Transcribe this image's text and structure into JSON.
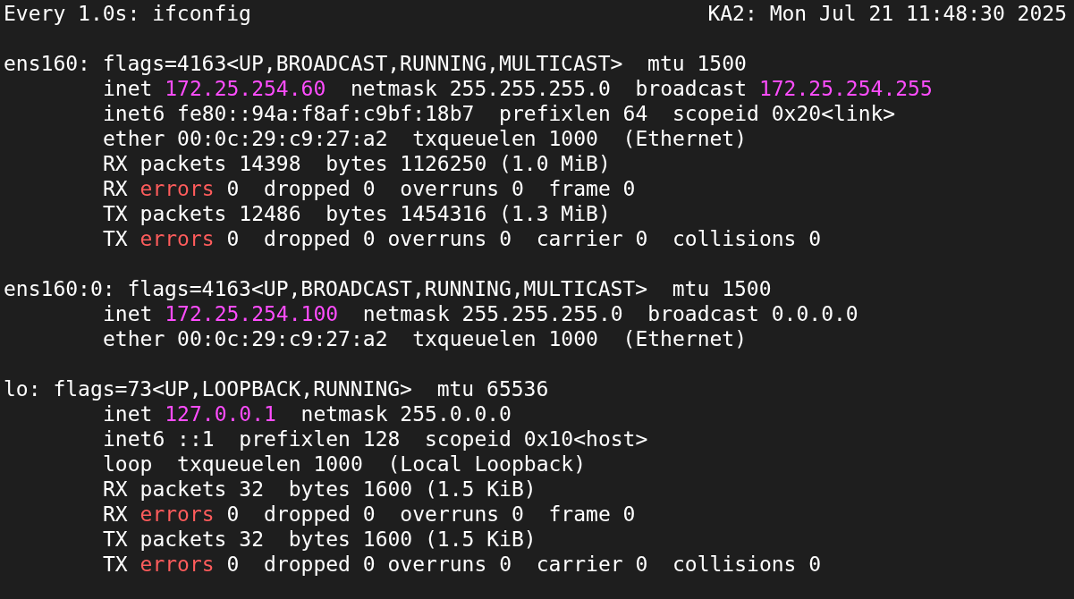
{
  "header": {
    "command": "Every 1.0s: ifconfig",
    "host_time": "KA2: Mon Jul 21 11:48:30 2025"
  },
  "interfaces": [
    {
      "segments": [
        {
          "text": "ens160: flags=4163<UP,BROADCAST,RUNNING,MULTICAST>  mtu 1500",
          "kind": "plain"
        }
      ],
      "children": [
        {
          "segments": [
            {
              "text": "inet ",
              "kind": "plain"
            },
            {
              "text": "172.25.254.60",
              "kind": "address"
            },
            {
              "text": "  netmask 255.255.255.0  broadcast ",
              "kind": "plain"
            },
            {
              "text": "172.25.254.255",
              "kind": "address"
            }
          ]
        },
        {
          "segments": [
            {
              "text": "inet6 fe80::94a:f8af:c9bf:18b7  prefixlen 64  scopeid 0x20<link>",
              "kind": "plain"
            }
          ]
        },
        {
          "segments": [
            {
              "text": "ether 00:0c:29:c9:27:a2  txqueuelen 1000  (Ethernet)",
              "kind": "plain"
            }
          ]
        },
        {
          "segments": [
            {
              "text": "RX packets 14398  bytes 1126250 (1.0 MiB)",
              "kind": "plain"
            }
          ]
        },
        {
          "segments": [
            {
              "text": "RX ",
              "kind": "plain"
            },
            {
              "text": "errors",
              "kind": "error"
            },
            {
              "text": " 0  dropped 0  overruns 0  frame 0",
              "kind": "plain"
            }
          ]
        },
        {
          "segments": [
            {
              "text": "TX packets 12486  bytes 1454316 (1.3 MiB)",
              "kind": "plain"
            }
          ]
        },
        {
          "segments": [
            {
              "text": "TX ",
              "kind": "plain"
            },
            {
              "text": "errors",
              "kind": "error"
            },
            {
              "text": " 0  dropped 0 overruns 0  carrier 0  collisions 0",
              "kind": "plain"
            }
          ]
        }
      ]
    },
    {
      "segments": [
        {
          "text": "ens160:0: flags=4163<UP,BROADCAST,RUNNING,MULTICAST>  mtu 1500",
          "kind": "plain"
        }
      ],
      "children": [
        {
          "segments": [
            {
              "text": "inet ",
              "kind": "plain"
            },
            {
              "text": "172.25.254.100",
              "kind": "address"
            },
            {
              "text": "  netmask 255.255.255.0  broadcast 0.0.0.0",
              "kind": "plain"
            }
          ]
        },
        {
          "segments": [
            {
              "text": "ether 00:0c:29:c9:27:a2  txqueuelen 1000  (Ethernet)",
              "kind": "plain"
            }
          ]
        }
      ]
    },
    {
      "segments": [
        {
          "text": "lo: flags=73<UP,LOOPBACK,RUNNING>  mtu 65536",
          "kind": "plain"
        }
      ],
      "children": [
        {
          "segments": [
            {
              "text": "inet ",
              "kind": "plain"
            },
            {
              "text": "127.0.0.1",
              "kind": "address"
            },
            {
              "text": "  netmask 255.0.0.0",
              "kind": "plain"
            }
          ]
        },
        {
          "segments": [
            {
              "text": "inet6 ::1  prefixlen 128  scopeid 0x10<host>",
              "kind": "plain"
            }
          ]
        },
        {
          "segments": [
            {
              "text": "loop  txqueuelen 1000  (Local Loopback)",
              "kind": "plain"
            }
          ]
        },
        {
          "segments": [
            {
              "text": "RX packets 32  bytes 1600 (1.5 KiB)",
              "kind": "plain"
            }
          ]
        },
        {
          "segments": [
            {
              "text": "RX ",
              "kind": "plain"
            },
            {
              "text": "errors",
              "kind": "error"
            },
            {
              "text": " 0  dropped 0  overruns 0  frame 0",
              "kind": "plain"
            }
          ]
        },
        {
          "segments": [
            {
              "text": "TX packets 32  bytes 1600 (1.5 KiB)",
              "kind": "plain"
            }
          ]
        },
        {
          "segments": [
            {
              "text": "TX ",
              "kind": "plain"
            },
            {
              "text": "errors",
              "kind": "error"
            },
            {
              "text": " 0  dropped 0 overruns 0  carrier 0  collisions 0",
              "kind": "plain"
            }
          ]
        }
      ]
    }
  ]
}
